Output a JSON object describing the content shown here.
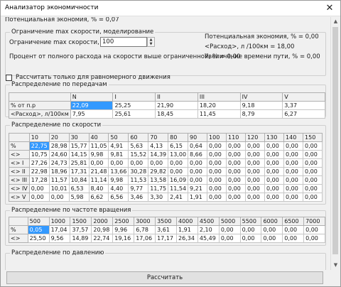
{
  "window": {
    "title": "Анализатор экономичности",
    "close_glyph": "✕"
  },
  "top_partial": "Потенциальная экономия, % = 0,07",
  "speed_limit": {
    "legend": "Ограничение max скорости, моделирование",
    "limit_label": "Ограничение max скорости, км/ч",
    "limit_value": "100",
    "percent_label": "Процент от полного расхода на скорости выше ограниченной, % = 0,00",
    "econ_label": "Потенциальная экономия, % = 0,00",
    "consumption_label": "<Расход>, л /100км = 18,00",
    "time_label": "Увеличение времени пути, % = 0,00"
  },
  "uniform_checkbox": {
    "label": "Рассчитать только для равномерного движения",
    "checked": false
  },
  "gears": {
    "legend": "Распределение по передачам",
    "headers": [
      "",
      "N",
      "I",
      "II",
      "III",
      "IV",
      "V"
    ],
    "rows": [
      [
        "% от п.р",
        "22,09",
        "25,25",
        "21,90",
        "18,20",
        "9,18",
        "3,37"
      ],
      [
        "<Расход>, л/100км",
        "7,95",
        "25,61",
        "18,45",
        "11,45",
        "8,79",
        "6,27"
      ]
    ]
  },
  "speed": {
    "legend": "Распределение по скорости",
    "headers": [
      "",
      "10",
      "20",
      "30",
      "40",
      "50",
      "60",
      "70",
      "80",
      "90",
      "100",
      "110",
      "120",
      "130",
      "140",
      "150"
    ],
    "rows": [
      [
        "%",
        "22,75",
        "28,98",
        "15,77",
        "11,05",
        "4,91",
        "5,63",
        "4,13",
        "6,15",
        "0,64",
        "0,00",
        "0,00",
        "0,00",
        "0,00",
        "0,00",
        "0,00"
      ],
      [
        "<>",
        "10,75",
        "24,60",
        "14,15",
        "9,98",
        "9,81",
        "15,52",
        "14,39",
        "13,00",
        "8,66",
        "0,00",
        "0,00",
        "0,00",
        "0,00",
        "0,00",
        "0,00"
      ],
      [
        "<> I",
        "27,26",
        "24,73",
        "25,81",
        "0,00",
        "0,00",
        "0,00",
        "0,00",
        "0,00",
        "0,00",
        "0,00",
        "0,00",
        "0,00",
        "0,00",
        "0,00",
        "0,00"
      ],
      [
        "<> II",
        "22,98",
        "18,96",
        "17,31",
        "21,48",
        "13,66",
        "30,28",
        "29,82",
        "0,00",
        "0,00",
        "0,00",
        "0,00",
        "0,00",
        "0,00",
        "0,00",
        "0,00"
      ],
      [
        "<> III",
        "17,28",
        "11,57",
        "10,84",
        "11,14",
        "9,98",
        "11,53",
        "13,58",
        "16,09",
        "0,00",
        "0,00",
        "0,00",
        "0,00",
        "0,00",
        "0,00",
        "0,00"
      ],
      [
        "<> IV",
        "0,00",
        "10,01",
        "6,53",
        "8,40",
        "4,40",
        "9,77",
        "11,75",
        "11,54",
        "9,21",
        "0,00",
        "0,00",
        "0,00",
        "0,00",
        "0,00",
        "0,00"
      ],
      [
        "<> V",
        "0,00",
        "0,00",
        "5,98",
        "6,62",
        "6,56",
        "3,46",
        "3,30",
        "2,41",
        "1,91",
        "0,00",
        "0,00",
        "0,00",
        "0,00",
        "0,00",
        "0,00"
      ]
    ]
  },
  "rpm": {
    "legend": "Распределение по частоте вращения",
    "headers": [
      "",
      "500",
      "1000",
      "1500",
      "2000",
      "2500",
      "3000",
      "3500",
      "4000",
      "4500",
      "5000",
      "5500",
      "6000",
      "6500",
      "7000"
    ],
    "rows": [
      [
        "%",
        "0,05",
        "17,04",
        "37,57",
        "20,98",
        "9,96",
        "6,78",
        "3,61",
        "1,91",
        "2,10",
        "0,00",
        "0,00",
        "0,00",
        "0,00",
        "0,00"
      ],
      [
        "<>",
        "25,50",
        "9,56",
        "14,89",
        "22,74",
        "19,16",
        "17,06",
        "17,17",
        "26,34",
        "45,49",
        "0,00",
        "0,00",
        "0,00",
        "0,00",
        "0,00"
      ]
    ]
  },
  "pressure": {
    "legend": "Распределение по давлению"
  },
  "calculate_button": "Рассчитать"
}
